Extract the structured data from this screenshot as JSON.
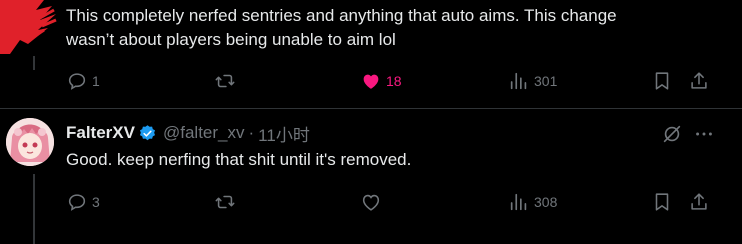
{
  "reply1": {
    "text_line1": "This completely nerfed sentries and anything that auto aims. This change",
    "text_line2": "wasn’t about players being unable to aim lol",
    "replies": "1",
    "likes": "18",
    "views": "301",
    "like_color": "#f91880",
    "icons": [
      "reply-icon",
      "retweet-icon",
      "heart-filled-icon",
      "views-icon",
      "bookmark-icon",
      "share-icon"
    ]
  },
  "reply2": {
    "display_name": "FalterXV",
    "handle": "@falter_xv",
    "separator": "·",
    "time": "11小时",
    "text": "Good. keep nerfing that shit until it's removed.",
    "replies": "3",
    "views": "308",
    "verified_color": "#1d9bf0",
    "icons": [
      "grok-icon",
      "more-icon",
      "reply-icon",
      "retweet-icon",
      "heart-icon",
      "views-icon",
      "bookmark-icon",
      "share-icon"
    ]
  },
  "colors": {
    "background": "#000000",
    "text": "#e7e9ea",
    "muted": "#71767b",
    "divider": "#2f3336",
    "redaction": "#e0212a"
  }
}
